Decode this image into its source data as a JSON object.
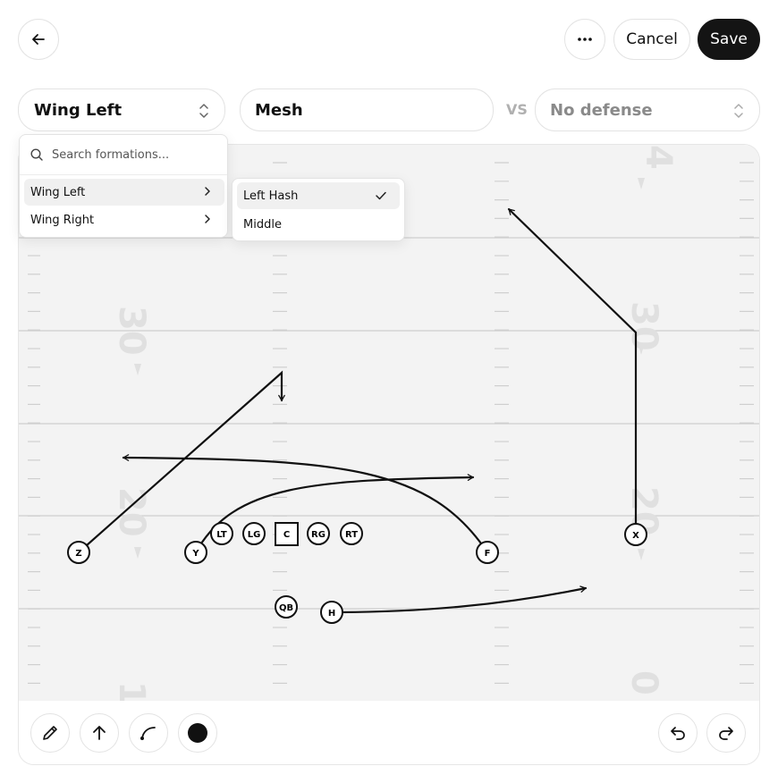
{
  "header": {
    "back_icon": "arrow-left-icon",
    "more_icon": "more-horizontal-icon",
    "cancel_label": "Cancel",
    "save_label": "Save"
  },
  "play": {
    "formation": "Wing Left",
    "name": "Mesh",
    "vs_label": "VS",
    "defense": "No defense"
  },
  "formation_menu": {
    "search_placeholder": "Search formations...",
    "items": [
      {
        "label": "Wing Left",
        "highlighted": true
      },
      {
        "label": "Wing Right",
        "highlighted": false
      }
    ]
  },
  "hash_menu": {
    "items": [
      {
        "label": "Left Hash",
        "selected": true
      },
      {
        "label": "Middle",
        "selected": false
      }
    ]
  },
  "field": {
    "yard_numbers": [
      "4",
      "30",
      "30",
      "20",
      "20",
      "1",
      "0"
    ],
    "players": [
      "Z",
      "Y",
      "LT",
      "LG",
      "C",
      "RG",
      "RT",
      "F",
      "X",
      "QB",
      "H"
    ]
  },
  "tools": {
    "items": [
      "pencil-icon",
      "arrow-up-icon",
      "curve-icon",
      "color-dot-icon"
    ],
    "undo_icon": "undo-icon",
    "redo_icon": "redo-icon"
  },
  "colors": {
    "field": "#f3f3f3",
    "line": "#cfcfcf",
    "route": "#111111",
    "save_button": "#141414"
  }
}
